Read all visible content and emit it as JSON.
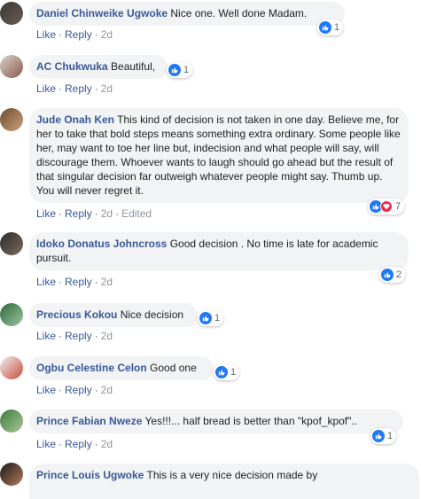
{
  "actions": {
    "like": "Like",
    "reply": "Reply",
    "sep": "·",
    "edited": "Edited"
  },
  "colors": {
    "author": "#385898",
    "bubble": "#f2f3f5",
    "like": "#2078f4",
    "love": "#f0284a"
  },
  "comments": [
    {
      "author": "Daniel Chinweike Ugwoke",
      "text": "Nice one. Well done Madam.",
      "time": "2d",
      "reactions": "1"
    },
    {
      "author": "AC Chukwuka",
      "text": "Beautiful,",
      "time": "2d",
      "reactions": "1"
    },
    {
      "author": "Jude Onah Ken",
      "text": "This kind of decision is not taken in one day. Believe me, for her to take that bold steps means something extra ordinary. Some people like her, may want to toe her line but, indecision and what people will say, will discourage them. Whoever wants to laugh should go ahead but the result of that singular decision far outweigh whatever people might say. Thumb up. You will never regret it.",
      "time": "2d",
      "edited": true,
      "reactions": "7"
    },
    {
      "author": "Idoko Donatus Johncross",
      "text": "Good decision . No time is late for academic pursuit.",
      "time": "2d",
      "reactions": "2"
    },
    {
      "author": "Precious Kokou",
      "text": "Nice decision",
      "time": "2d",
      "reactions": "1"
    },
    {
      "author": "Ogbu Celestine Celon",
      "text": "Good one",
      "time": "2d",
      "reactions": "1"
    },
    {
      "author": "Prince Fabian Nweze",
      "text": "Yes!!!... half bread is better than \"kpof_kpof\"..",
      "time": "2d",
      "reactions": "1"
    },
    {
      "author": "Prince Louis Ugwoke",
      "text": "This is a very nice decision made by"
    }
  ]
}
